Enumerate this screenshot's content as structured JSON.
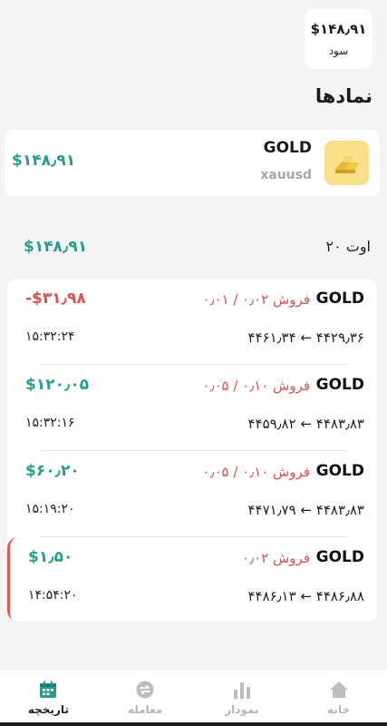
{
  "profit_summary": {
    "value": "$۱۴۸٫۹۱",
    "label": "سود"
  },
  "section_title": "نمادها",
  "symbol": {
    "name": "GOLD",
    "code": "xauusd",
    "profit": "$۱۴۸٫۹۱"
  },
  "day": {
    "label": "اوت ۲۰",
    "total": "$۱۴۸٫۹۱"
  },
  "trades": [
    {
      "symbol": "GOLD",
      "desc": "فروش ۰٫۰۲ / ۰٫۰۱",
      "pnl": "-$۳۱٫۹۸",
      "prices": "۴۴۲۹٫۳۶ ← ۴۴۶۱٫۳۴",
      "time": "۱۵:۳۲:۲۴"
    },
    {
      "symbol": "GOLD",
      "desc": "فروش ۰٫۱۰ / ۰٫۰۵",
      "pnl": "$۱۲۰٫۰۵",
      "prices": "۴۴۸۳٫۸۳ ← ۴۴۵۹٫۸۲",
      "time": "۱۵:۳۲:۱۶"
    },
    {
      "symbol": "GOLD",
      "desc": "فروش ۰٫۱۰ / ۰٫۰۵",
      "pnl": "$۶۰٫۲۰",
      "prices": "۴۴۸۳٫۸۳ ← ۴۴۷۱٫۷۹",
      "time": "۱۵:۱۹:۲۰"
    },
    {
      "symbol": "GOLD",
      "desc": "فروش ۰٫۰۲",
      "pnl": "$۱٫۵۰",
      "prices": "۴۴۸۶٫۸۸ ← ۴۴۸۶٫۱۳",
      "time": "۱۴:۵۴:۲۰"
    }
  ],
  "nav": [
    {
      "label": "خانه",
      "icon": "home-icon"
    },
    {
      "label": "نمودار",
      "icon": "chart-icon"
    },
    {
      "label": "معامله",
      "icon": "trade-icon"
    },
    {
      "label": "تاریخچه",
      "icon": "calendar-icon"
    }
  ],
  "colors": {
    "profit": "#2a9d8f",
    "loss": "#d9534f",
    "gold": "#fbe08a"
  }
}
